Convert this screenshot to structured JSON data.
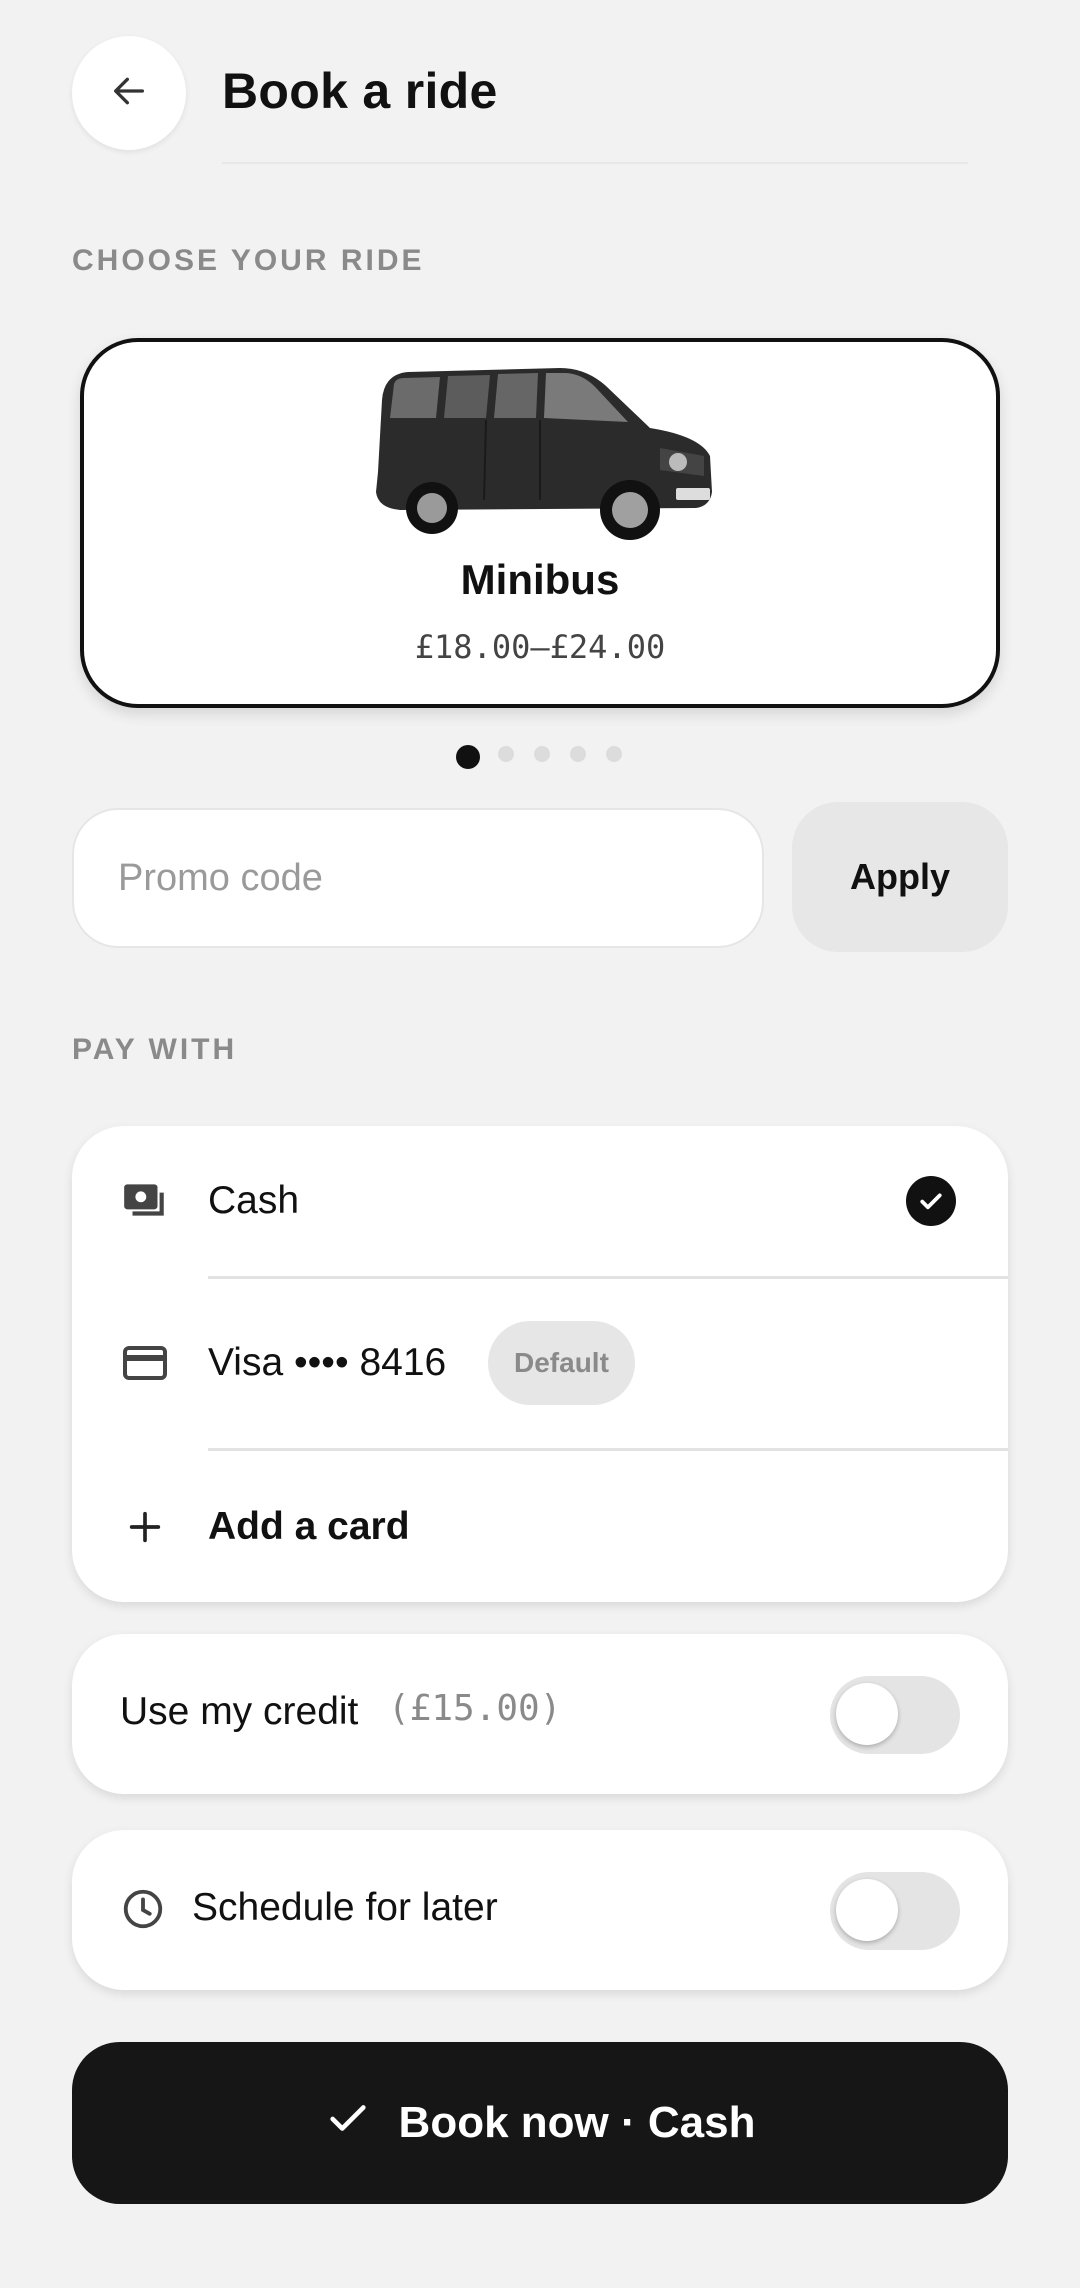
{
  "header": {
    "title": "Book a ride",
    "back_icon": "arrow-left-icon"
  },
  "ride_section": {
    "label": "CHOOSE YOUR RIDE",
    "selected_ride": {
      "name": "Minibus",
      "price_range": "£18.00–£24.00",
      "image": "minibus-image"
    },
    "carousel": {
      "count": 5,
      "active_index": 0
    }
  },
  "promo": {
    "placeholder": "Promo code",
    "value": "",
    "apply_label": "Apply"
  },
  "pay_section": {
    "label": "PAY WITH",
    "methods": [
      {
        "label": "Cash",
        "icon": "cash-icon",
        "selected": true
      },
      {
        "label": "Visa •••• 8416",
        "icon": "credit-card-icon",
        "badge": "Default",
        "selected": false
      },
      {
        "label": "Add a card",
        "icon": "plus-icon"
      }
    ]
  },
  "credit": {
    "label": "Use my credit",
    "amount": "(£15.00)",
    "enabled": false
  },
  "schedule": {
    "label": "Schedule for later",
    "icon": "clock-icon",
    "enabled": false
  },
  "book_button": {
    "label": "Book now · Cash",
    "icon": "check-icon"
  },
  "colors": {
    "background": "#f2f2f2",
    "primary": "#161616",
    "muted_text": "#8a8a8a",
    "card": "#ffffff"
  }
}
